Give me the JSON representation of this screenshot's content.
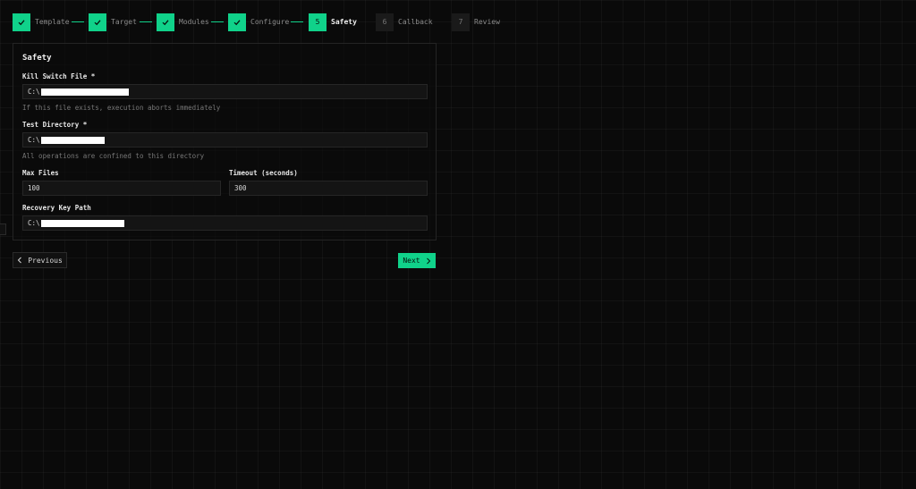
{
  "stepper": {
    "steps": [
      {
        "number": "1",
        "label": "Template",
        "state": "done"
      },
      {
        "number": "2",
        "label": "Target",
        "state": "done"
      },
      {
        "number": "3",
        "label": "Modules",
        "state": "done"
      },
      {
        "number": "4",
        "label": "Configure",
        "state": "done"
      },
      {
        "number": "5",
        "label": "Safety",
        "state": "active"
      },
      {
        "number": "6",
        "label": "Callback",
        "state": "todo"
      },
      {
        "number": "7",
        "label": "Review",
        "state": "todo"
      }
    ],
    "done_icon": "check-icon"
  },
  "form": {
    "title": "Safety",
    "kill_switch": {
      "label": "Kill Switch File *",
      "value_prefix": "C:\\",
      "hint": "If this file exists, execution aborts immediately"
    },
    "test_directory": {
      "label": "Test Directory *",
      "value_prefix": "C:\\",
      "hint": "All operations are confined to this directory"
    },
    "max_files": {
      "label": "Max Files",
      "value": "100"
    },
    "timeout": {
      "label": "Timeout (seconds)",
      "value": "300"
    },
    "recovery_key": {
      "label": "Recovery Key Path",
      "value_prefix": "C:\\"
    }
  },
  "nav": {
    "previous_label": "Previous",
    "previous_icon": "chevron-left-icon",
    "next_label": "Next",
    "next_icon": "chevron-right-icon"
  },
  "colors": {
    "accent": "#10d28a",
    "background": "#0a0a0a",
    "inactive_step": "#1a1a1a"
  }
}
